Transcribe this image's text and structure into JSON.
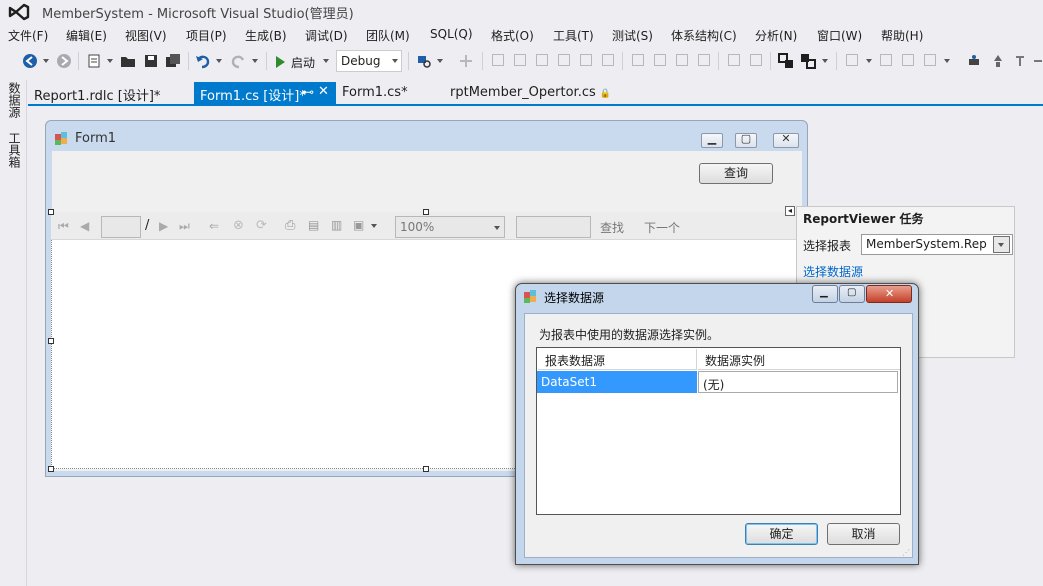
{
  "app": {
    "title": "MemberSystem - Microsoft Visual Studio(管理员)"
  },
  "menu": [
    "文件(F)",
    "编辑(E)",
    "视图(V)",
    "项目(P)",
    "生成(B)",
    "调试(D)",
    "团队(M)",
    "SQL(Q)",
    "格式(O)",
    "工具(T)",
    "测试(S)",
    "体系结构(C)",
    "分析(N)",
    "窗口(W)",
    "帮助(H)"
  ],
  "toolbar": {
    "start_label": "启动",
    "config": "Debug"
  },
  "left_strip": {
    "tab1": "数据源",
    "tab2": "工具箱"
  },
  "tabs": [
    {
      "label": "Report1.rdlc [设计]*",
      "active": false
    },
    {
      "label": "Form1.cs [设计]*",
      "active": true,
      "pin": "⊷",
      "close": "✕"
    },
    {
      "label": "Form1.cs*",
      "active": false
    },
    {
      "label": "rptMember_Opertor.cs",
      "active": false,
      "lock": "🔒"
    }
  ],
  "form": {
    "title": "Form1",
    "query_button": "查询"
  },
  "report_viewer": {
    "page_sep": "/",
    "zoom": "100%",
    "find_label": "查找",
    "next_label": "下一个"
  },
  "tasks": {
    "title": "ReportViewer 任务",
    "choose_report_label": "选择报表",
    "choose_report_value": "MemberSystem.Rep",
    "choose_datasource_link": "选择数据源"
  },
  "dialog": {
    "title": "选择数据源",
    "description": "为报表中使用的数据源选择实例。",
    "columns": [
      "报表数据源",
      "数据源实例"
    ],
    "rows": [
      {
        "source": "DataSet1",
        "instance": "(无)"
      }
    ],
    "ok": "确定",
    "cancel": "取消"
  },
  "colors": {
    "accent": "#007acc",
    "selection": "#3399ff",
    "link": "#0066cc"
  }
}
